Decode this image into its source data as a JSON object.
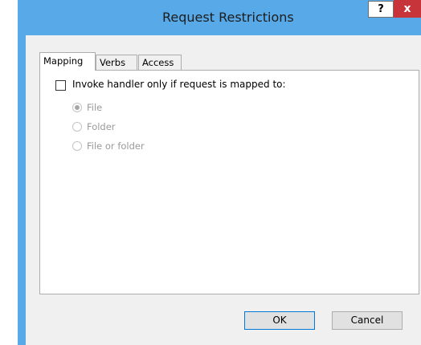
{
  "window": {
    "title": "Request Restrictions",
    "help_label": "?",
    "close_label": "x"
  },
  "tabs": [
    {
      "label": "Mapping",
      "active": true
    },
    {
      "label": "Verbs",
      "active": false
    },
    {
      "label": "Access",
      "active": false
    }
  ],
  "mapping": {
    "checkbox_label": "Invoke handler only if request is mapped to:",
    "checkbox_checked": false,
    "options": [
      {
        "label": "File",
        "selected": true,
        "enabled": false
      },
      {
        "label": "Folder",
        "selected": false,
        "enabled": false
      },
      {
        "label": "File or folder",
        "selected": false,
        "enabled": false
      }
    ]
  },
  "buttons": {
    "ok_label": "OK",
    "cancel_label": "Cancel"
  },
  "colors": {
    "accent": "#57a9e8",
    "close": "#c7343a",
    "disabled_text": "#9a9a9a"
  }
}
